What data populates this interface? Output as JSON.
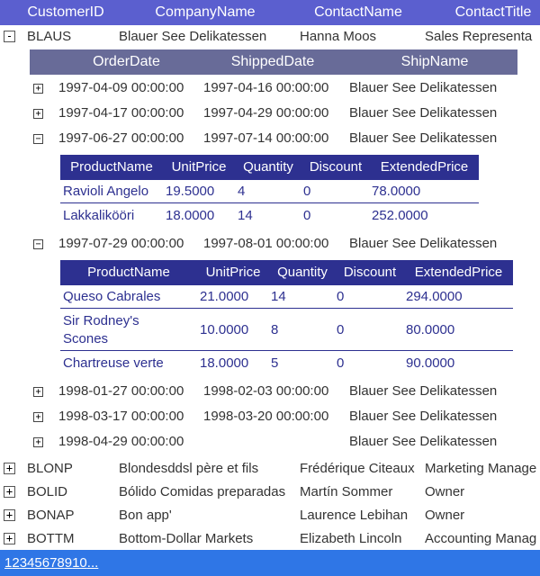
{
  "master_columns": [
    "CustomerID",
    "CompanyName",
    "ContactName",
    "ContactTitle"
  ],
  "expanded_customer": {
    "toggle": "-",
    "id": "BLAUS",
    "company": "Blauer See Delikatessen",
    "contact": "Hanna Moos",
    "title": "Sales Representa"
  },
  "order_columns": [
    "OrderDate",
    "ShippedDate",
    "ShipName"
  ],
  "orders": [
    {
      "toggle": "+",
      "order_date": "1997-04-09 00:00:00",
      "shipped_date": "1997-04-16 00:00:00",
      "ship_name": "Blauer See Delikatessen"
    },
    {
      "toggle": "+",
      "order_date": "1997-04-17 00:00:00",
      "shipped_date": "1997-04-29 00:00:00",
      "ship_name": "Blauer See Delikatessen"
    },
    {
      "toggle": "−",
      "order_date": "1997-06-27 00:00:00",
      "shipped_date": "1997-07-14 00:00:00",
      "ship_name": "Blauer See Delikatessen"
    },
    {
      "toggle": "−",
      "order_date": "1997-07-29 00:00:00",
      "shipped_date": "1997-08-01 00:00:00",
      "ship_name": "Blauer See Delikatessen"
    },
    {
      "toggle": "+",
      "order_date": "1998-01-27 00:00:00",
      "shipped_date": "1998-02-03 00:00:00",
      "ship_name": "Blauer See Delikatessen"
    },
    {
      "toggle": "+",
      "order_date": "1998-03-17 00:00:00",
      "shipped_date": "1998-03-20 00:00:00",
      "ship_name": "Blauer See Delikatessen"
    },
    {
      "toggle": "+",
      "order_date": "1998-04-29 00:00:00",
      "shipped_date": "",
      "ship_name": "Blauer See Delikatessen"
    }
  ],
  "product_columns": [
    "ProductName",
    "UnitPrice",
    "Quantity",
    "Discount",
    "ExtendedPrice"
  ],
  "details_a": [
    {
      "product": "Ravioli Angelo",
      "price": "19.5000",
      "qty": "4",
      "discount": "0",
      "extended": "78.0000"
    },
    {
      "product": "Lakkalikööri",
      "price": "18.0000",
      "qty": "14",
      "discount": "0",
      "extended": "252.0000"
    }
  ],
  "details_b": [
    {
      "product": "Queso Cabrales",
      "price": "21.0000",
      "qty": "14",
      "discount": "0",
      "extended": "294.0000"
    },
    {
      "product": "Sir Rodney's Scones",
      "price": "10.0000",
      "qty": "8",
      "discount": "0",
      "extended": "80.0000"
    },
    {
      "product": "Chartreuse verte",
      "price": "18.0000",
      "qty": "5",
      "discount": "0",
      "extended": "90.0000"
    }
  ],
  "customers": [
    {
      "toggle": "+",
      "id": "BLONP",
      "company": "Blondesddsl père et fils",
      "contact": "Frédérique Citeaux",
      "title": "Marketing Manage"
    },
    {
      "toggle": "+",
      "id": "BOLID",
      "company": "Bólido Comidas preparadas",
      "contact": "Martín Sommer",
      "title": "Owner"
    },
    {
      "toggle": "+",
      "id": "BONAP",
      "company": "Bon app'",
      "contact": "Laurence Lebihan",
      "title": "Owner"
    },
    {
      "toggle": "+",
      "id": "BOTTM",
      "company": "Bottom-Dollar Markets",
      "contact": "Elizabeth Lincoln",
      "title": "Accounting Manag"
    }
  ],
  "pager": {
    "pages": [
      "1",
      "2",
      "3",
      "4",
      "5",
      "6",
      "7",
      "8",
      "9",
      "10",
      "..."
    ]
  },
  "colors": {
    "master_header": "#5b5fcf",
    "order_header": "#686b98",
    "detail_header": "#2d3090",
    "pager": "#2f76e6"
  }
}
